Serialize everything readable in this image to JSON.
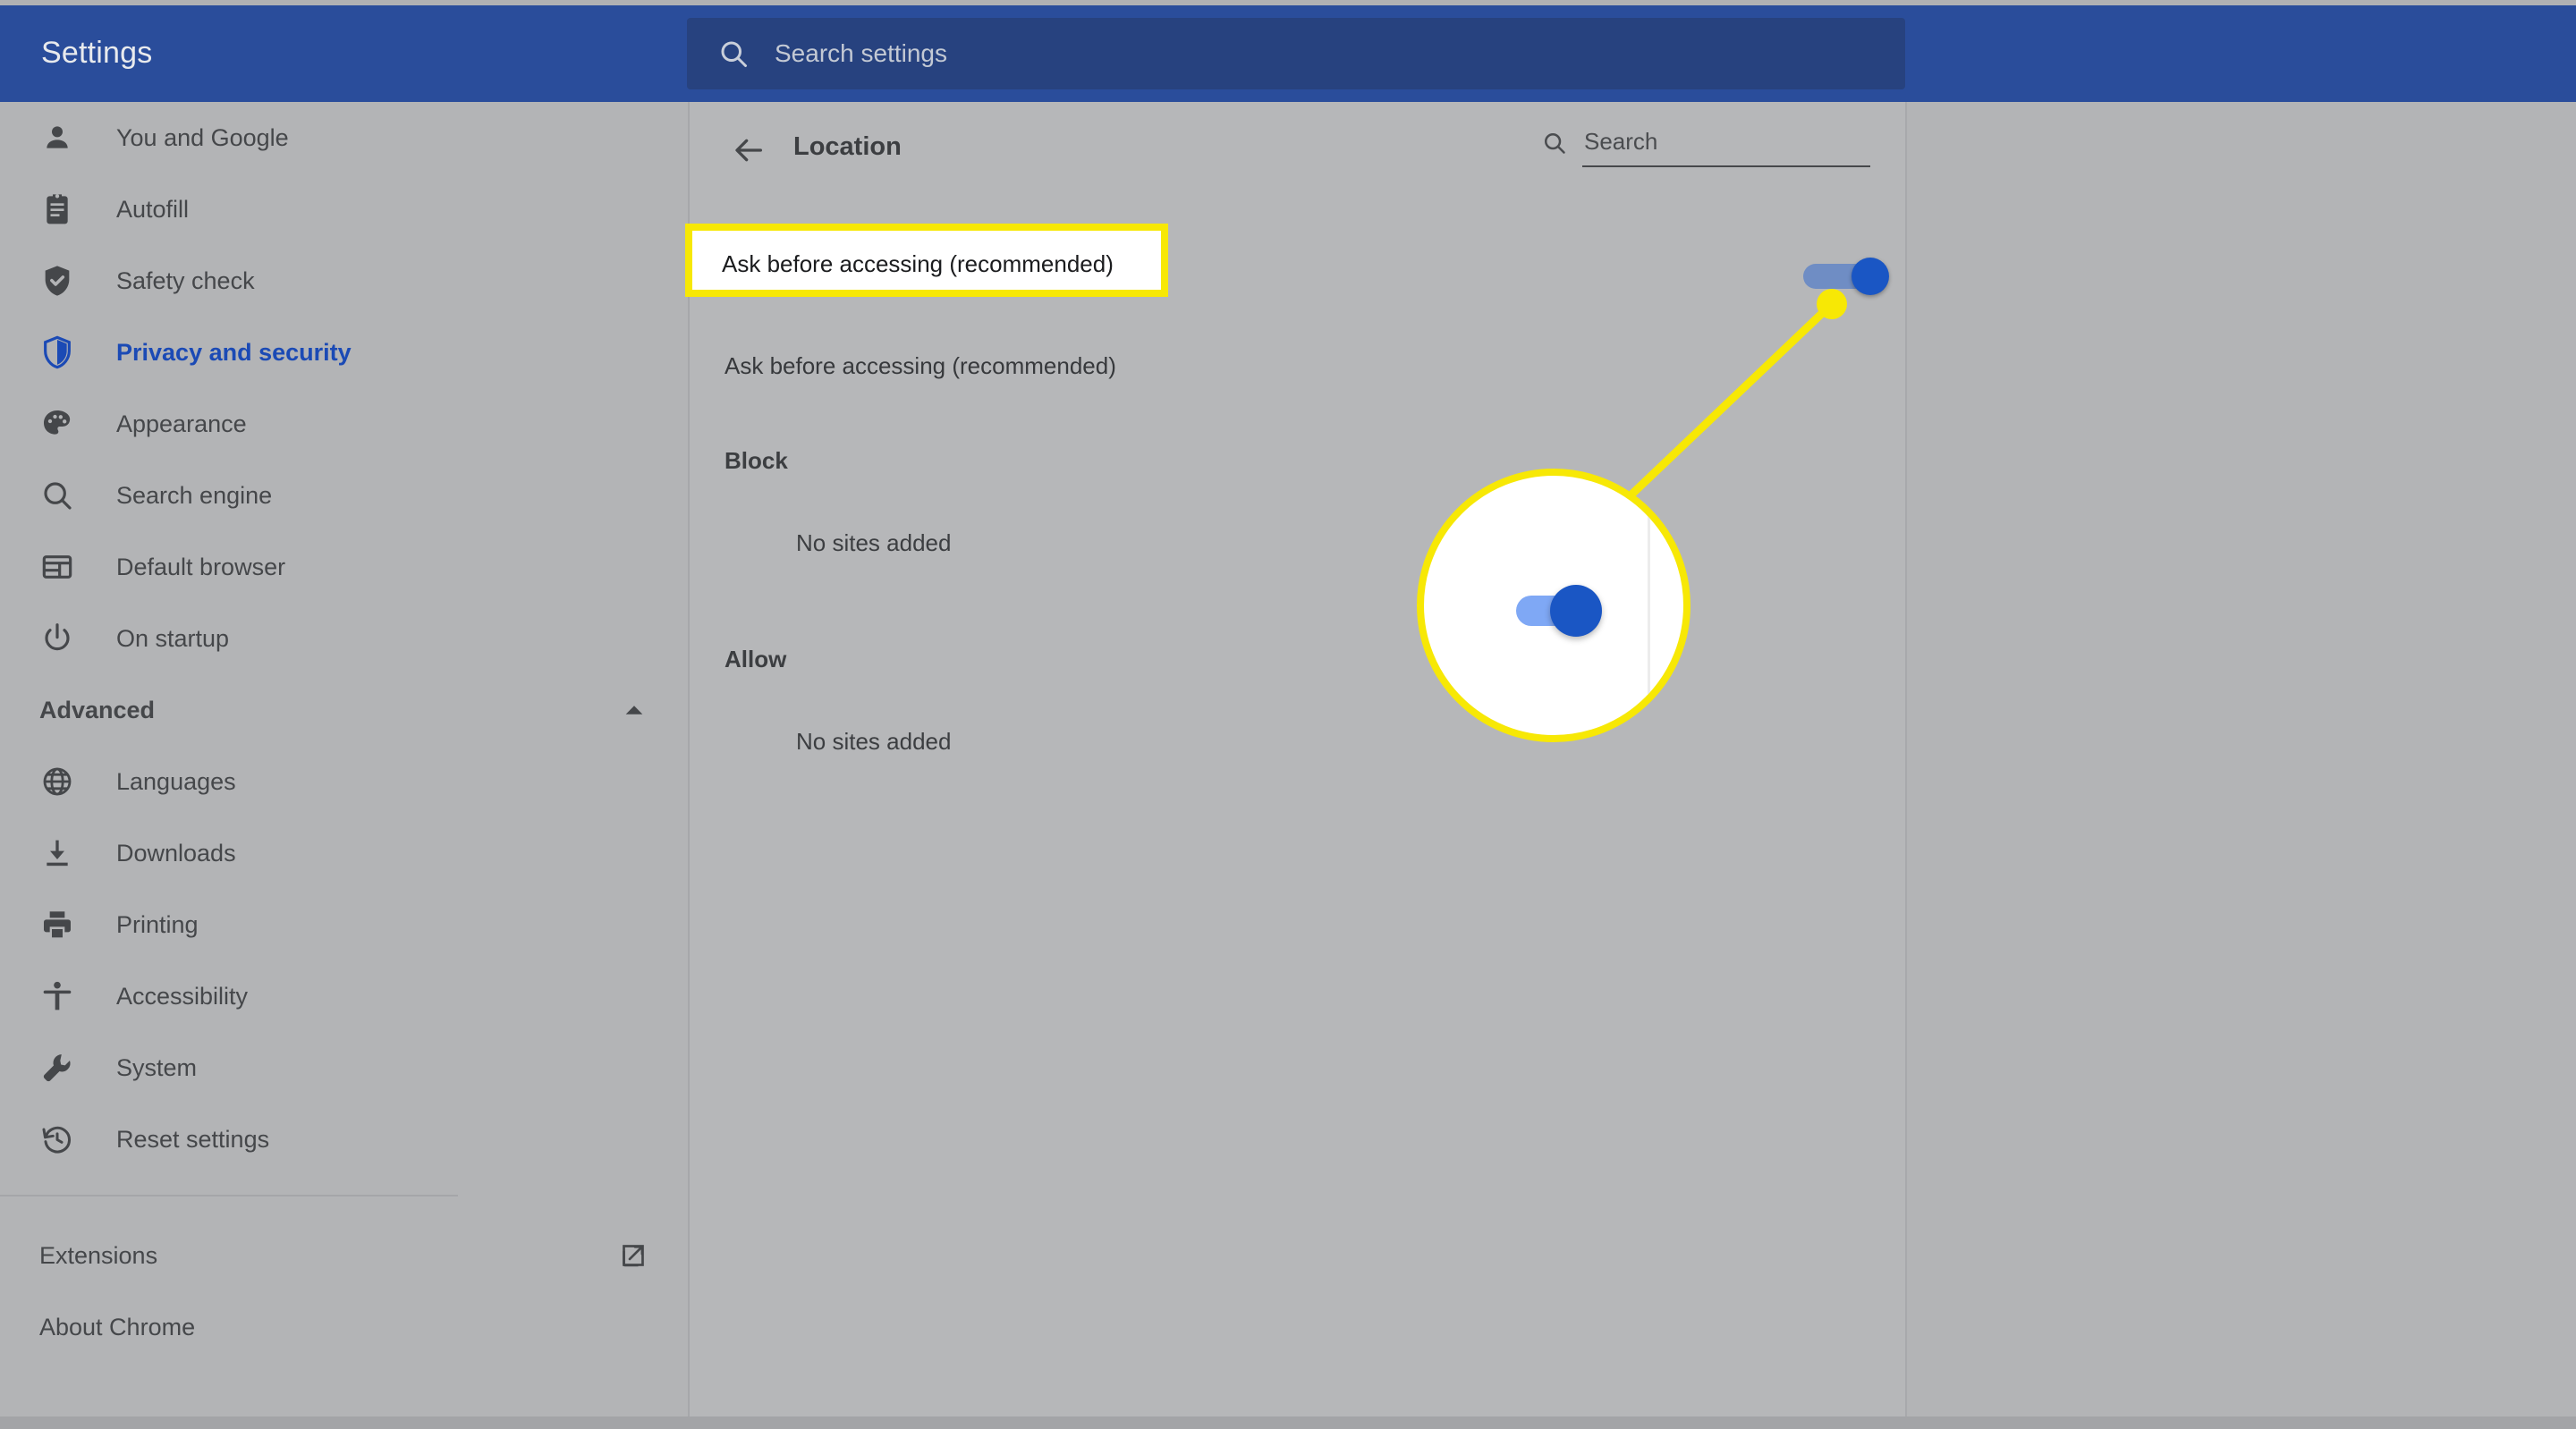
{
  "header": {
    "title": "Settings",
    "search_placeholder": "Search settings",
    "search_value": "",
    "search_icon": "search-icon",
    "bg_color": "#2a4d9b"
  },
  "sidebar": {
    "items": [
      {
        "label": "You and Google",
        "icon": "person-icon",
        "active": false
      },
      {
        "label": "Autofill",
        "icon": "clipboard-icon",
        "active": false
      },
      {
        "label": "Safety check",
        "icon": "shield-check-icon",
        "active": false
      },
      {
        "label": "Privacy and security",
        "icon": "shield-half-icon",
        "active": true
      },
      {
        "label": "Appearance",
        "icon": "palette-icon",
        "active": false
      },
      {
        "label": "Search engine",
        "icon": "search-icon",
        "active": false
      },
      {
        "label": "Default browser",
        "icon": "browser-window-icon",
        "active": false
      },
      {
        "label": "On startup",
        "icon": "power-icon",
        "active": false
      }
    ],
    "advanced": {
      "label": "Advanced",
      "expanded": true,
      "caret_icon": "chevron-up-icon",
      "items": [
        {
          "label": "Languages",
          "icon": "globe-icon"
        },
        {
          "label": "Downloads",
          "icon": "download-icon"
        },
        {
          "label": "Printing",
          "icon": "printer-icon"
        },
        {
          "label": "Accessibility",
          "icon": "accessibility-icon"
        },
        {
          "label": "System",
          "icon": "wrench-icon"
        },
        {
          "label": "Reset settings",
          "icon": "history-restore-icon"
        }
      ]
    },
    "footer": [
      {
        "label": "Extensions",
        "icon": "external-link-icon",
        "has_external": true
      },
      {
        "label": "About Chrome",
        "icon": "",
        "has_external": false
      }
    ],
    "active_color": "#1b4ab5",
    "text_color": "#45474a"
  },
  "main": {
    "back_icon": "arrow-left-icon",
    "title": "Location",
    "search_icon": "search-icon",
    "search_placeholder": "Search",
    "search_value": "",
    "ask_setting": {
      "label": "Ask before accessing (recommended)",
      "toggle_state": "on",
      "toggle_on_color": "#1a56c4",
      "toggle_track_color": "#6f8dc4"
    },
    "sections": [
      {
        "title": "Block",
        "empty_text": "No sites added"
      },
      {
        "title": "Allow",
        "empty_text": "No sites added"
      }
    ]
  },
  "annotation": {
    "highlight_color": "#f7e805",
    "highlight_box_label": "Ask before accessing (recommended)",
    "magnifier_label": "location-toggle-magnified"
  }
}
